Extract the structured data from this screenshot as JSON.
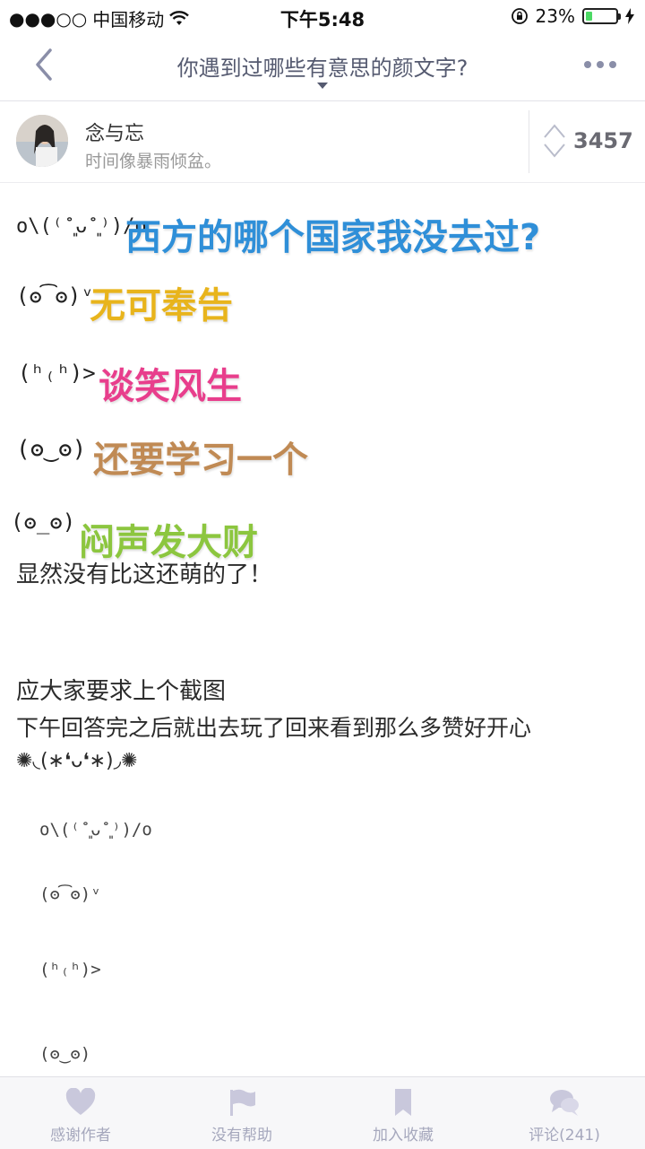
{
  "status_bar": {
    "signal": "●●●○○",
    "carrier": "中国移动",
    "time": "下午5:48",
    "battery_text": "23%",
    "battery_level": 0.23
  },
  "nav": {
    "title": "你遇到过哪些有意思的颜文字?"
  },
  "author": {
    "name": "念与忘",
    "bio": "时间像暴雨倾盆。",
    "votes": "3457"
  },
  "answer": {
    "rows": [
      {
        "kaomoji": "o\\(⁽˚͈ᴗ˚͈⁾)/o",
        "text": "西方的哪个国家我没去过?",
        "color": "#2f8fd8"
      },
      {
        "kaomoji": "(ʘ͡ʘ)ᵛ",
        "text": "无可奉告",
        "color": "#e8b41c"
      },
      {
        "kaomoji": "(ʰ₍ʰ)>",
        "text": "谈笑风生",
        "color": "#e83e8c"
      },
      {
        "kaomoji": "(ʘ‿ʘ)",
        "text": "还要学习一个",
        "color": "#c08a54"
      },
      {
        "kaomoji": "(ʘ̲ʘ)",
        "text": "闷声发大财",
        "color": "#8cc63f"
      }
    ],
    "line1": "显然没有比这还萌的了！",
    "line2": "应大家要求上个截图",
    "line3": "下午回答完之后就出去玩了回来看到那么多赞好开心",
    "line4": "✺◟(∗❛ᴗ❛∗)◞✺",
    "small_kaomoji": [
      "o\\(⁽˚͈ᴗ˚͈⁾)/o",
      "(ʘ͡ʘ)ᵛ",
      "(ʰ₍ʰ)>",
      "(ʘ‿ʘ)"
    ]
  },
  "tabbar": {
    "thanks": "感谢作者",
    "unhelpful": "没有帮助",
    "collect": "加入收藏",
    "comments": "评论(241)"
  },
  "colors": {
    "accent": "#555a70",
    "tab_icon": "#c9c8dc",
    "tab_label": "#a6a8bd"
  }
}
